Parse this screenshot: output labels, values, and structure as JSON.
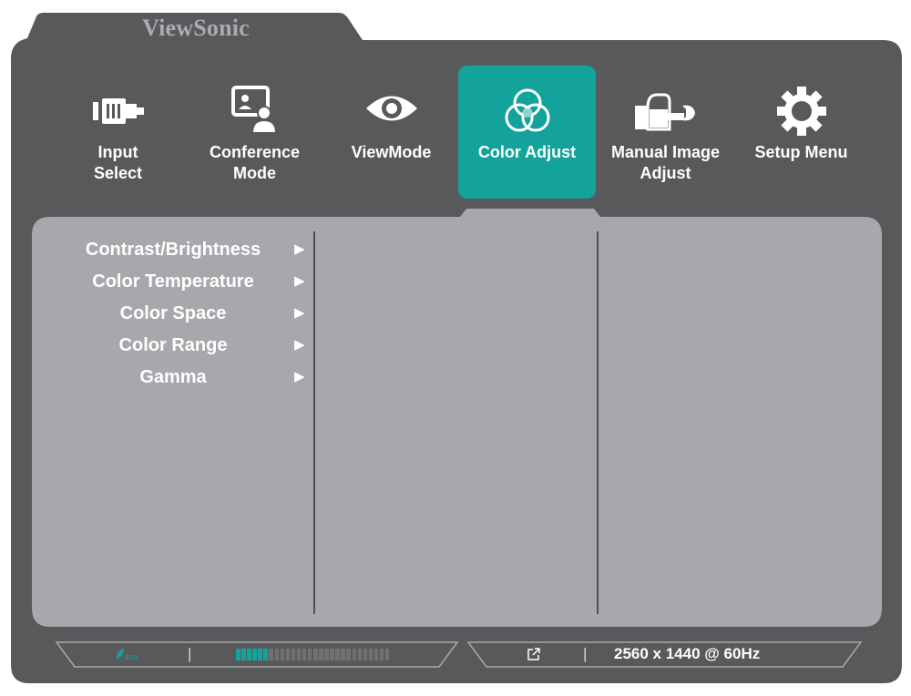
{
  "brand": "ViewSonic",
  "colors": {
    "frame": "#58595b",
    "accent": "#14a39a",
    "content": "#a6a8ab",
    "divider": "#4f5052",
    "text": "#ffffff"
  },
  "tabs": [
    {
      "label": "Input\nSelect",
      "icon": "input-select-icon",
      "active": false
    },
    {
      "label": "Conference\nMode",
      "icon": "conference-mode-icon",
      "active": false
    },
    {
      "label": "ViewMode",
      "icon": "eye-icon",
      "active": false
    },
    {
      "label": "Color Adjust",
      "icon": "color-circles-icon",
      "active": true
    },
    {
      "label": "Manual Image\nAdjust",
      "icon": "hand-wrench-icon",
      "active": false
    },
    {
      "label": "Setup Menu",
      "icon": "gear-icon",
      "active": false
    }
  ],
  "menu": [
    {
      "label": "Contrast/Brightness",
      "arrow": "▶"
    },
    {
      "label": "Color Temperature",
      "arrow": "▶"
    },
    {
      "label": "Color Space",
      "arrow": "▶"
    },
    {
      "label": "Color Range",
      "arrow": "▶"
    },
    {
      "label": "Gamma",
      "arrow": "▶"
    }
  ],
  "status": {
    "eco_icon": "eco-icon",
    "eco_label": "eco",
    "separator": "|",
    "power_level": 0.2,
    "power_segments": 28,
    "link_icon": "external-link-icon",
    "resolution": "2560 x 1440 @ 60Hz"
  }
}
